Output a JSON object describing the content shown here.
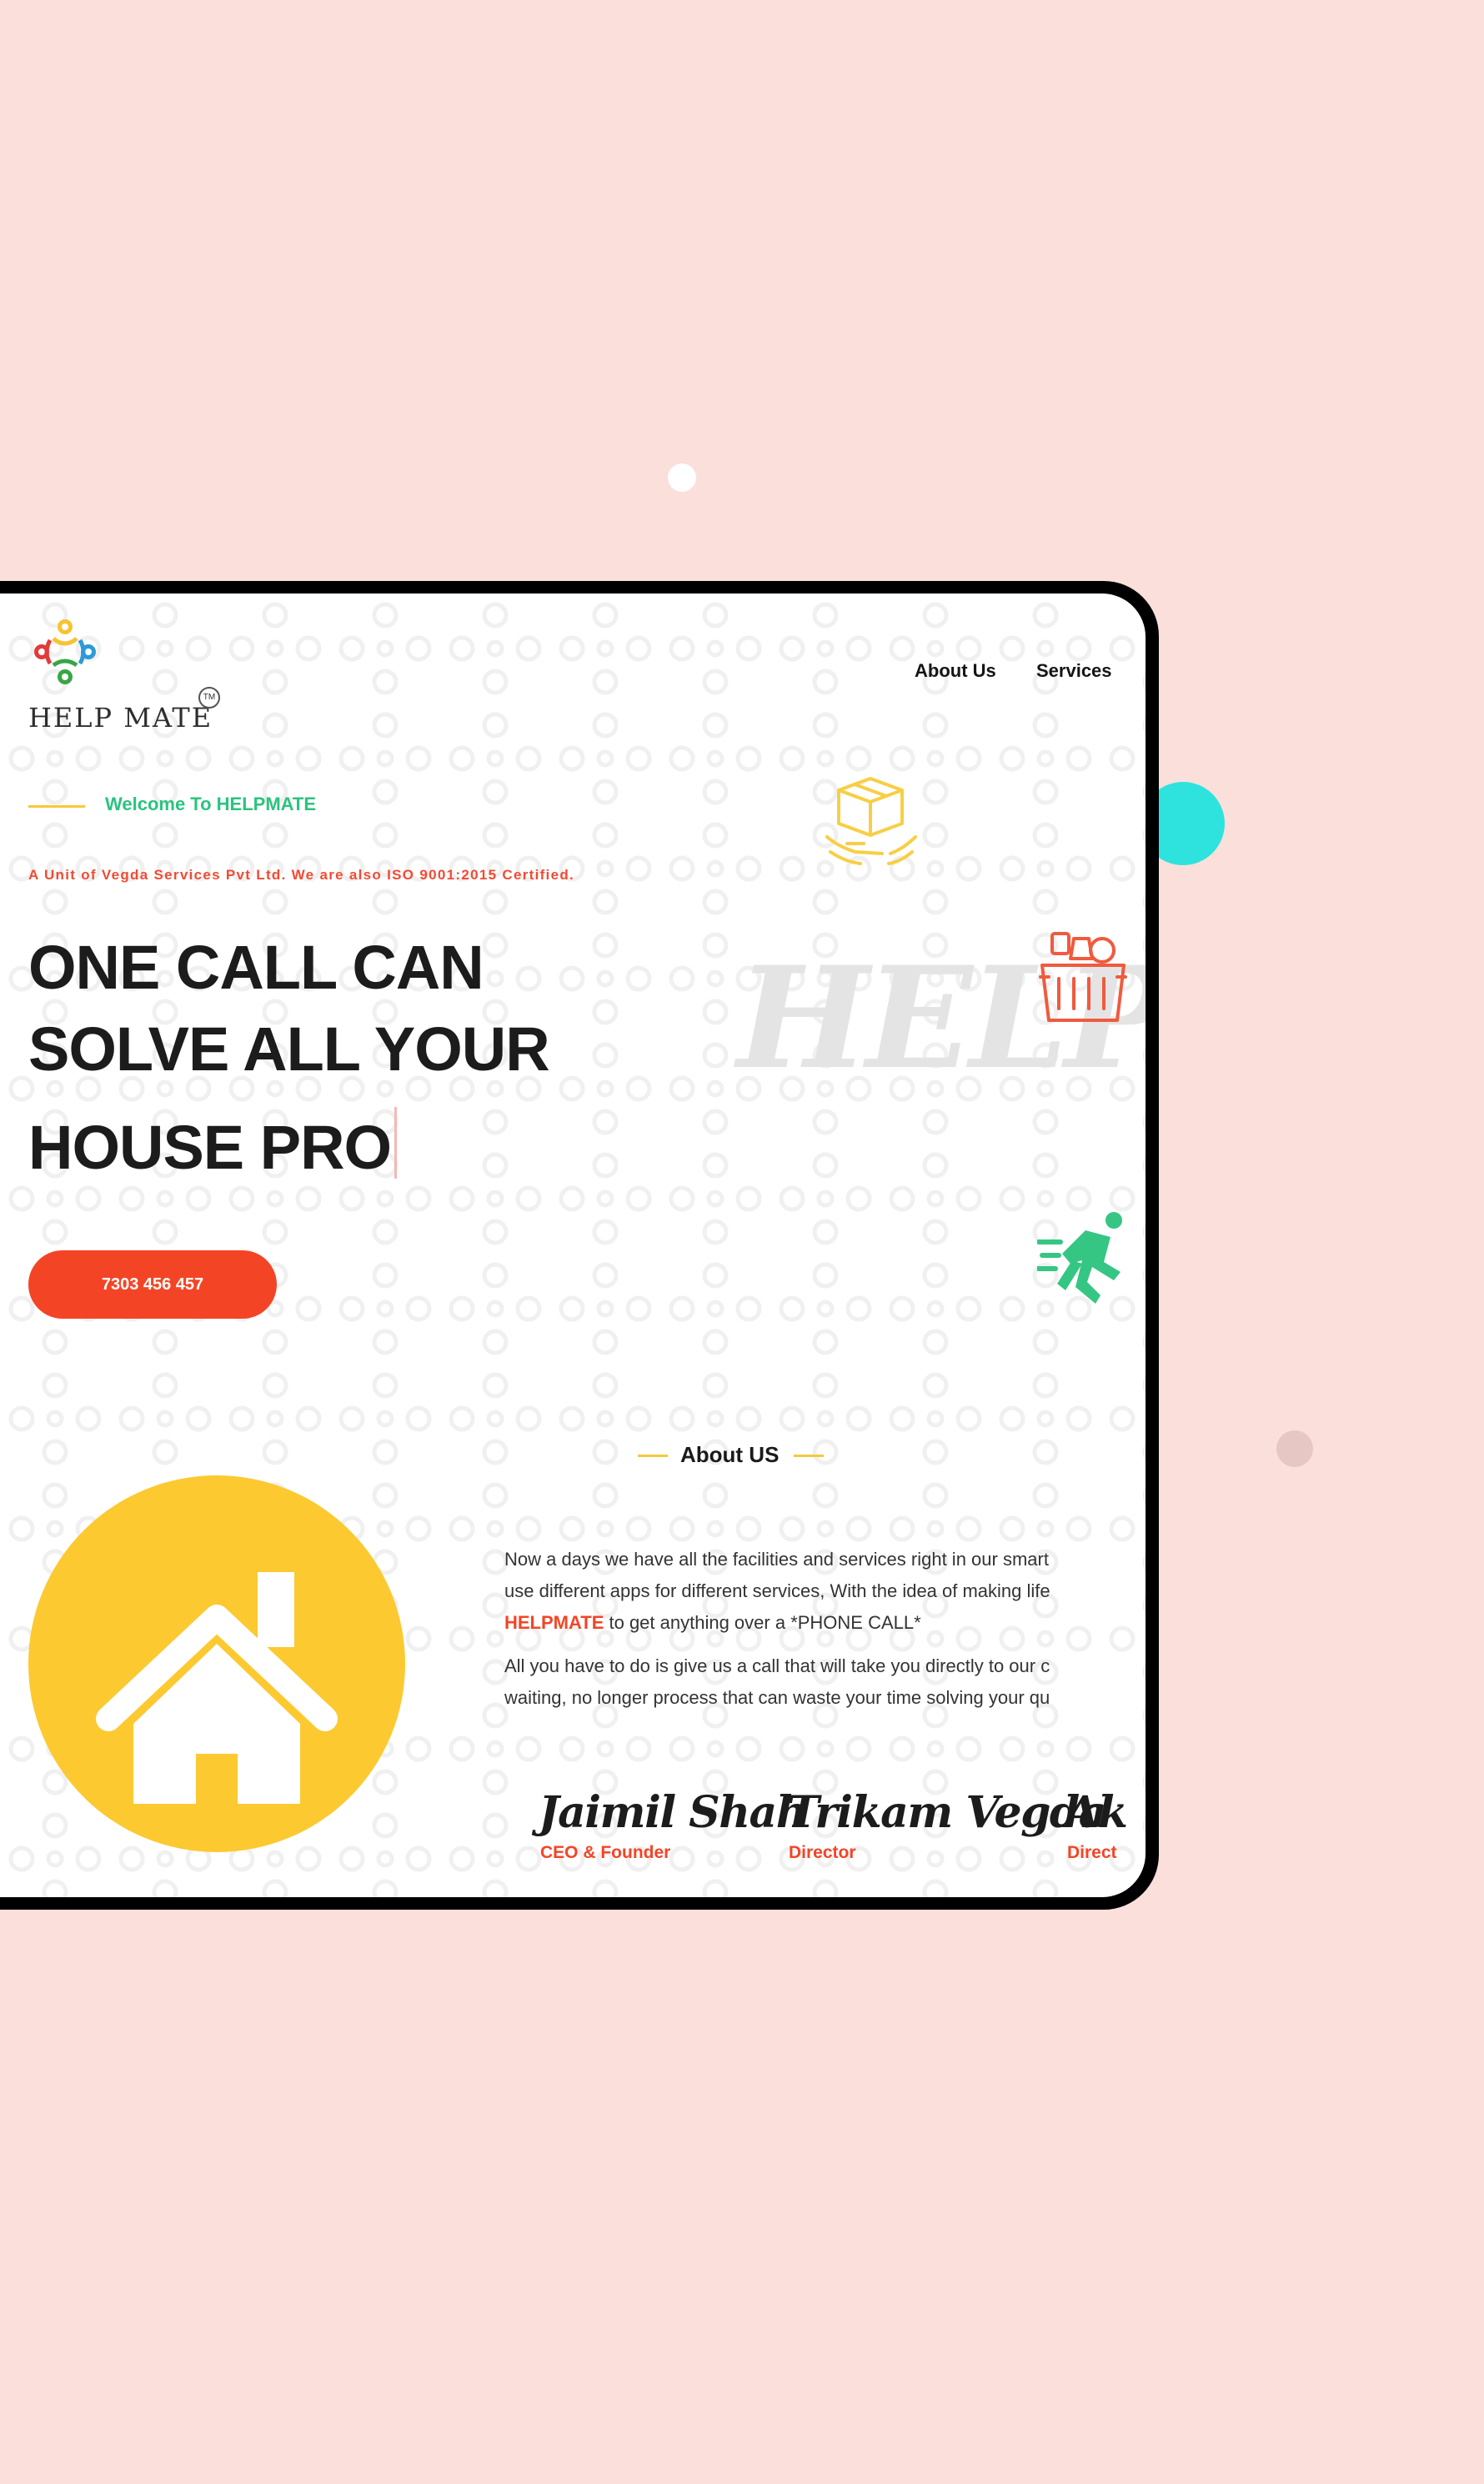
{
  "brand": {
    "logo_text": "HELP MATE",
    "tm": "TM"
  },
  "nav": {
    "about": "About Us",
    "services": "Services"
  },
  "hero": {
    "welcome": "Welcome To HELPMATE",
    "unit": "A Unit of Vegda Services Pvt Ltd. We are also ISO 9001:2015 Certified.",
    "headline_lines": [
      "ONE CALL CAN",
      "SOLVE ALL YOUR",
      "HOUSE PRO"
    ],
    "help_word": "HELP",
    "phone": "7303 456 457"
  },
  "about": {
    "heading": "About US",
    "para1_line1": "Now a days we have all the facilities and services right in our smart",
    "para1_line2": "use different apps for different services, With the idea of making life",
    "para1_brand": "HELPMATE",
    "para1_line3_rest": " to get anything over a *PHONE CALL*",
    "para2_line1": "All you have to do is give us a call that will take you directly to our c",
    "para2_line2": "waiting, no longer process that can waste your time solving your qu"
  },
  "team": [
    {
      "name": "Jaimil Shah",
      "role": "CEO & Founder"
    },
    {
      "name": "Trikam Vegda",
      "role": "Director"
    },
    {
      "name": "Ak",
      "role": "Direct"
    }
  ],
  "colors": {
    "background": "#fbdfdb",
    "accent_red": "#f34526",
    "accent_green": "#2bc37f",
    "accent_yellow": "#fcc930",
    "accent_cyan": "#2ee3de"
  },
  "icons": [
    "box-hands-icon",
    "grocery-basket-icon",
    "running-man-icon",
    "house-icon"
  ]
}
